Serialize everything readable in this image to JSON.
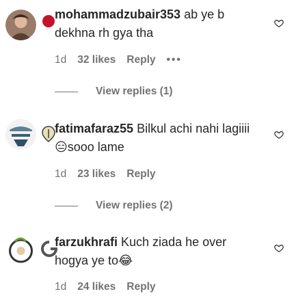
{
  "comments": [
    {
      "username": "mohammadzubair353",
      "text_line1": " ab ye b",
      "text_line2": "dekhna rh gya tha",
      "time": "1d",
      "likes": "32 likes",
      "reply": "Reply",
      "more": "•••",
      "view_replies": "View replies (1)"
    },
    {
      "username": "fatimafaraz55",
      "text_line1": " Bilkul achi nahi lagiiii",
      "emoji": "😑",
      "text_line2": "sooo lame",
      "time": "1d",
      "likes": "23 likes",
      "reply": "Reply",
      "view_replies": "View replies (2)"
    },
    {
      "username": "farzukhrafi",
      "text_line1": " Kuch ziada he over",
      "text_line2": "hogya ye to",
      "emoji": "😂",
      "time": "1d",
      "likes": "24 likes",
      "reply": "Reply"
    }
  ],
  "colors": {
    "text": "#262626",
    "secondary": "#737373"
  }
}
